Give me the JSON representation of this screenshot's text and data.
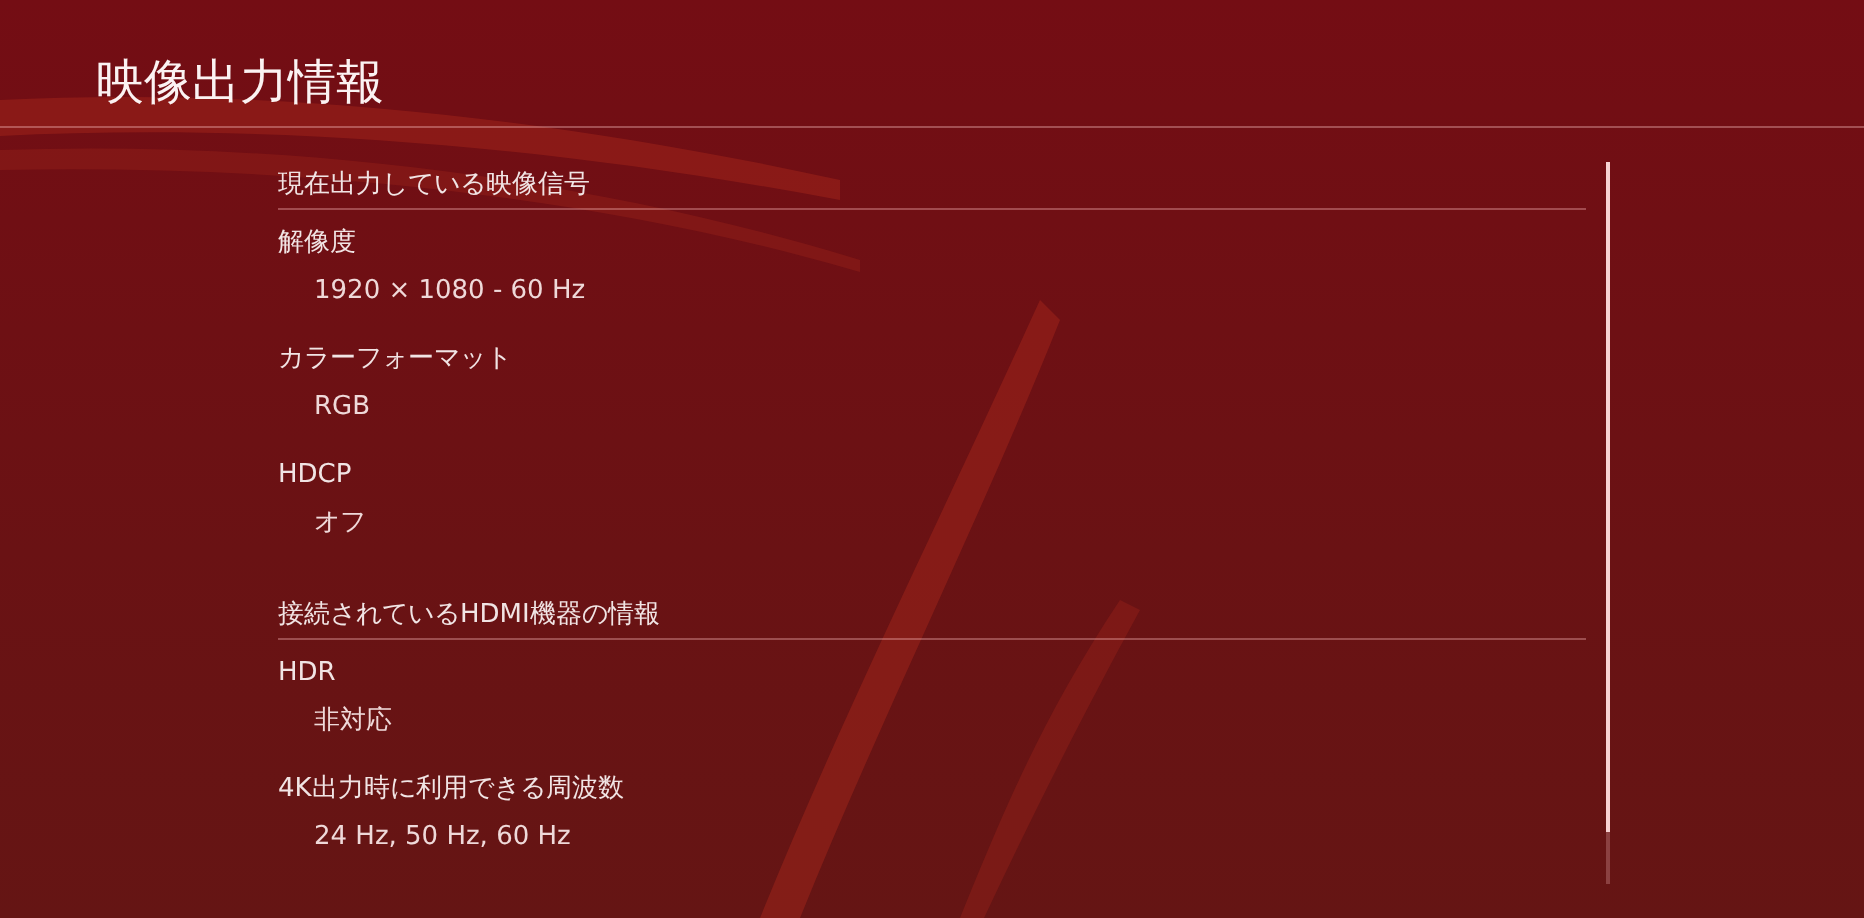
{
  "title": "映像出力情報",
  "sections": [
    {
      "heading": "現在出力している映像信号",
      "items": [
        {
          "label": "解像度",
          "value": "1920 × 1080 - 60 Hz"
        },
        {
          "label": "カラーフォーマット",
          "value": "RGB"
        },
        {
          "label": "HDCP",
          "value": "オフ"
        }
      ]
    },
    {
      "heading": "接続されているHDMI機器の情報",
      "items": [
        {
          "label": "HDR",
          "value": "非対応"
        },
        {
          "label": "4K出力時に利用できる周波数",
          "value": "24 Hz, 50 Hz, 60 Hz"
        }
      ]
    }
  ]
}
